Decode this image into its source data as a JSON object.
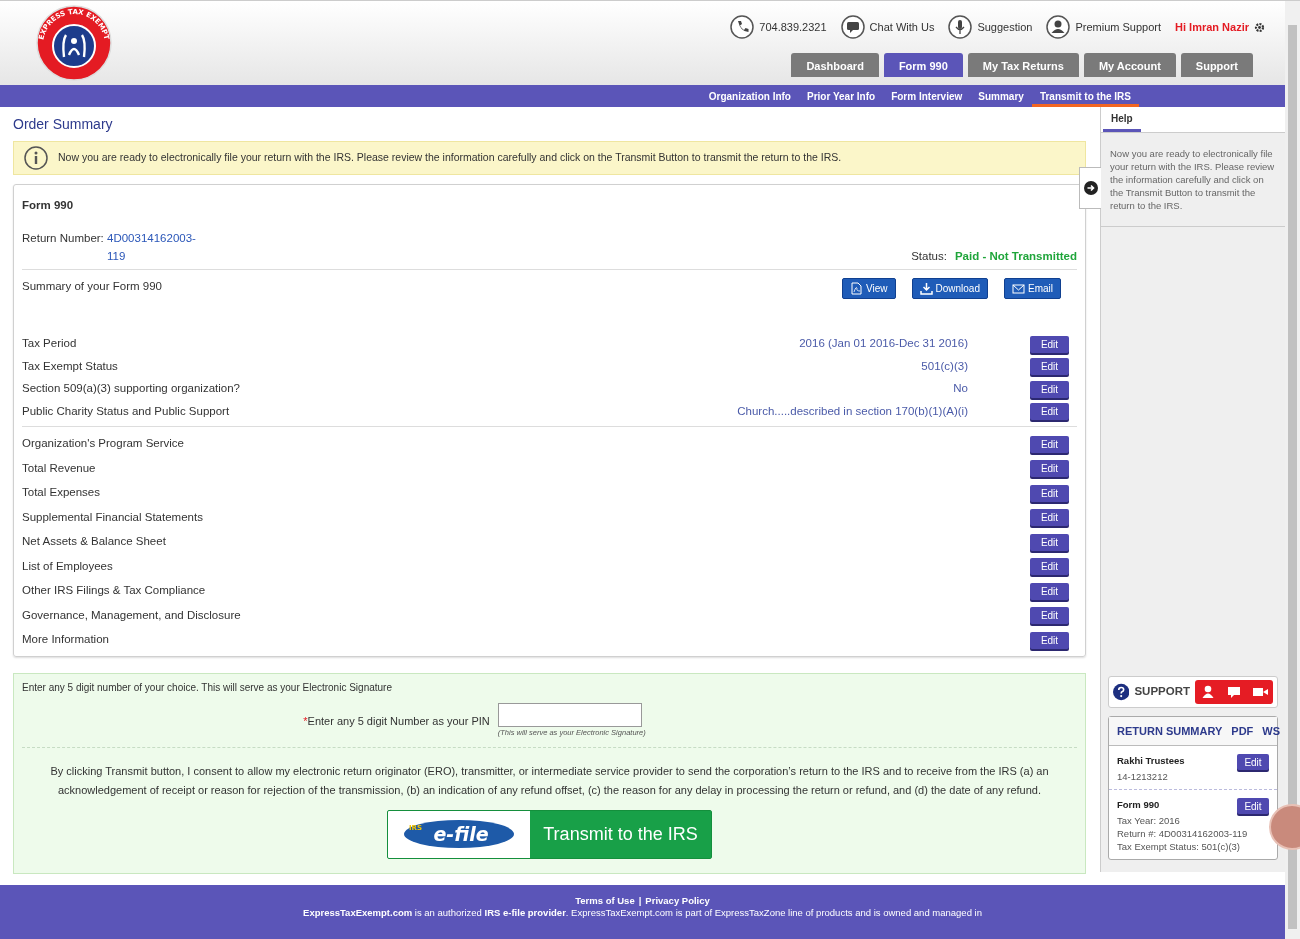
{
  "logo": {
    "text": "EXPRESS TAX EXEMPT"
  },
  "header": {
    "phone": "704.839.2321",
    "links": [
      {
        "label": "Chat With Us",
        "kind": "chat"
      },
      {
        "label": "Suggestion",
        "kind": "mic"
      },
      {
        "label": "Premium Support",
        "kind": "person"
      }
    ],
    "greeting": "Hi Imran Nazir"
  },
  "main_tabs": [
    {
      "label": "Dashboard",
      "selected": false
    },
    {
      "label": "Form 990",
      "selected": true
    },
    {
      "label": "My Tax Returns",
      "selected": false
    },
    {
      "label": "My Account",
      "selected": false
    },
    {
      "label": "Support",
      "selected": false
    }
  ],
  "sub_nav": [
    {
      "label": "Organization Info",
      "selected": false
    },
    {
      "label": "Prior Year Info",
      "selected": false
    },
    {
      "label": "Form Interview",
      "selected": false
    },
    {
      "label": "Summary",
      "selected": false
    },
    {
      "label": "Transmit to the IRS",
      "selected": true
    }
  ],
  "page_title": "Order Summary",
  "alert": "Now you are ready to electronically file your return with the IRS. Please review the information carefully and click on the Transmit Button to transmit the return to the IRS.",
  "form_card": {
    "title": "Form 990",
    "return_number_label": "Return Number:",
    "return_number": "4D00314162003-119",
    "status_label": "Status:",
    "status_value": "Paid - Not Transmitted",
    "summary_label": "Summary of your Form 990",
    "actions": [
      {
        "label": "View",
        "kind": "pdf"
      },
      {
        "label": "Download",
        "kind": "download"
      },
      {
        "label": "Email",
        "kind": "email"
      }
    ],
    "groups": [
      {
        "rows": [
          {
            "label": "Tax Period",
            "value": "2016 (Jan 01 2016-Dec 31 2016)",
            "edit": "Edit"
          },
          {
            "label": "Tax Exempt Status",
            "value": "501(c)(3)",
            "edit": "Edit"
          },
          {
            "label": "Section 509(a)(3) supporting organization?",
            "value": "No",
            "edit": "Edit"
          },
          {
            "label": "Public Charity Status and Public Support",
            "value": "Church.....described in section 170(b)(1)(A)(i)",
            "edit": "Edit"
          }
        ]
      },
      {
        "rows": [
          {
            "label": "Organization's Program Service",
            "edit": "Edit"
          },
          {
            "label": "Total Revenue",
            "edit": "Edit"
          },
          {
            "label": "Total Expenses",
            "edit": "Edit"
          },
          {
            "label": "Supplemental Financial Statements",
            "edit": "Edit"
          },
          {
            "label": "Net Assets & Balance Sheet",
            "edit": "Edit"
          },
          {
            "label": "List of Employees",
            "edit": "Edit"
          },
          {
            "label": "Other IRS Filings & Tax Compliance",
            "edit": "Edit"
          },
          {
            "label": "Governance, Management, and Disclosure",
            "edit": "Edit"
          },
          {
            "label": "More Information",
            "edit": "Edit"
          }
        ]
      }
    ]
  },
  "signature": {
    "note": "Enter any 5 digit number of your choice. This will serve as your Electronic Signature",
    "required_mark": "*",
    "pin_label": "Enter any 5 digit Number as your PIN",
    "pin_hint": "(This will serve as your Electronic Signature)",
    "consent": "By clicking Transmit button, I consent to allow my electronic return originator (ERO), transmitter, or intermediate service provider to send the corporation’s return to the IRS and to receive from the IRS (a) an acknowledgement of receipt or reason for rejection of the transmission, (b) an indication of any refund offset, (c) the reason for any delay in processing the return or refund, and (d) the date of any refund.",
    "transmit": {
      "logo_small": "IRS",
      "logo": "e-file",
      "label": "Transmit to the IRS"
    }
  },
  "help": {
    "tab": "Help",
    "text": "Now you are ready to electronically file your return with the IRS. Please review the information carefully and click on the Transmit Button to transmit the return to the IRS."
  },
  "support": {
    "label": "SUPPORT"
  },
  "return_summary": {
    "title": "RETURN SUMMARY",
    "links": [
      "PDF",
      "WS"
    ],
    "entries": [
      {
        "title": "Rakhi Trustees",
        "lines": [
          "14-1213212"
        ],
        "edit": "Edit"
      },
      {
        "title": "Form 990",
        "lines": [
          "Tax Year: 2016",
          "Return #: 4D00314162003-119",
          "Tax Exempt Status: 501(c)(3)"
        ],
        "edit": "Edit"
      }
    ]
  },
  "footer": {
    "links": [
      "Terms of Use",
      "Privacy Policy"
    ],
    "separator": "|",
    "text": "**ExpressTaxExempt.com** is an authorized **IRS e-file provider**. ExpressTaxExempt.com is part of ExpressTaxZone line of products and is owned and managed in"
  }
}
